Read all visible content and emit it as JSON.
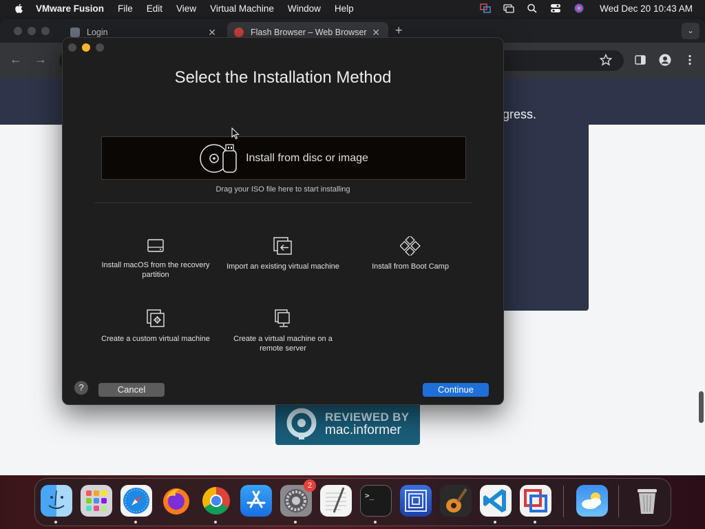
{
  "menubar": {
    "app_name": "VMware Fusion",
    "items": [
      "File",
      "Edit",
      "View",
      "Virtual Machine",
      "Window",
      "Help"
    ],
    "clock": "Wed Dec 20  10:43 AM"
  },
  "browser": {
    "tabs": [
      {
        "label": "Login"
      },
      {
        "label": "Flash Browser – Web Browser"
      }
    ],
    "page_text": "gress.",
    "badge": {
      "line1": "REVIEWED BY",
      "line2": "mac.informer"
    }
  },
  "dialog": {
    "title": "Select the Installation Method",
    "drop_zone_label": "Install from disc or image",
    "drop_hint": "Drag your ISO file here to start installing",
    "options": [
      {
        "label": "Install macOS from the recovery partition",
        "icon": "drive-icon"
      },
      {
        "label": "Import an existing virtual machine",
        "icon": "import-icon"
      },
      {
        "label": "Install from Boot Camp",
        "icon": "bootcamp-icon"
      },
      {
        "label": "Create a custom virtual machine",
        "icon": "custom-vm-icon"
      },
      {
        "label": "Create a virtual machine on a remote server",
        "icon": "remote-server-icon"
      }
    ],
    "help_label": "?",
    "cancel_label": "Cancel",
    "continue_label": "Continue"
  },
  "dock": {
    "apps": [
      "Finder",
      "Launchpad",
      "Safari",
      "Firefox",
      "Chrome",
      "App Store",
      "System Settings",
      "TextEdit",
      "Terminal",
      "Quartz Filter",
      "GarageBand",
      "Visual Studio Code",
      "VMware Fusion",
      "Weather",
      "Trash"
    ],
    "settings_badge": "2"
  },
  "colors": {
    "accent": "#1f6fd8",
    "dialog_bg": "#1e1e1e",
    "page_header": "#2e3449"
  }
}
